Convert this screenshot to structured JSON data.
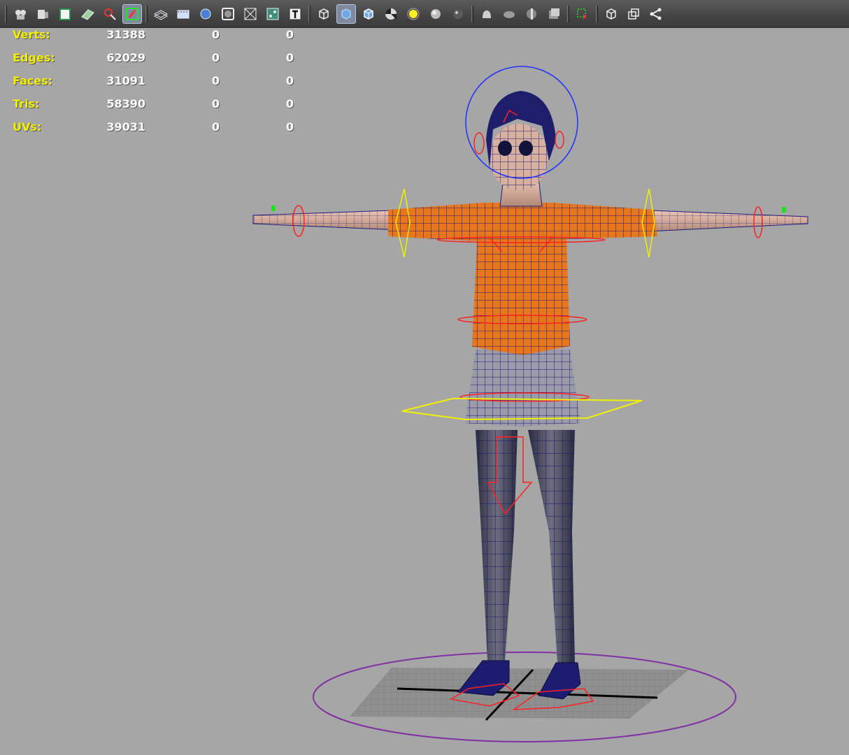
{
  "toolbar": {
    "groups": [
      [
        {
          "icon": "camera-attributes-icon",
          "active": false
        },
        {
          "icon": "camera-film-icon",
          "active": false
        },
        {
          "icon": "bookmark-icon",
          "active": false
        },
        {
          "icon": "image-plane-icon",
          "active": false
        },
        {
          "icon": "two-d-pan-zoom-icon",
          "active": false
        },
        {
          "icon": "grease-pencil-icon",
          "active": true
        }
      ],
      [
        {
          "icon": "grid-icon",
          "active": false
        },
        {
          "icon": "film-gate-icon",
          "active": false
        },
        {
          "icon": "resolution-gate-icon",
          "active": false
        },
        {
          "icon": "gate-mask-icon",
          "active": false
        },
        {
          "icon": "field-chart-icon",
          "active": false
        },
        {
          "icon": "safe-action-icon",
          "active": false
        },
        {
          "icon": "safe-title-icon",
          "active": false
        }
      ],
      [
        {
          "icon": "wireframe-cube-icon",
          "active": false
        },
        {
          "icon": "smooth-shade-cube-icon",
          "active": true
        },
        {
          "icon": "wireframe-on-shaded-icon",
          "active": false
        },
        {
          "icon": "textured-checker-icon",
          "active": false
        },
        {
          "icon": "use-all-lights-icon",
          "active": false
        },
        {
          "icon": "shadows-sphere-icon",
          "active": false
        },
        {
          "icon": "ambient-occlusion-sphere-icon",
          "active": false
        }
      ],
      [
        {
          "icon": "motion-blur-icon",
          "active": false
        },
        {
          "icon": "multisample-aa-icon",
          "active": false
        },
        {
          "icon": "depth-of-field-icon",
          "active": false
        },
        {
          "icon": "screen-space-icon",
          "active": false
        }
      ],
      [
        {
          "icon": "isolate-select-icon",
          "active": false
        }
      ],
      [
        {
          "icon": "xray-cube-icon",
          "active": false
        },
        {
          "icon": "xray-active-components-icon",
          "active": false
        },
        {
          "icon": "xray-joints-icon",
          "active": false
        }
      ]
    ]
  },
  "hud": {
    "rows": [
      {
        "label": "Verts:",
        "v1": "31388",
        "v2": "0",
        "v3": "0"
      },
      {
        "label": "Edges:",
        "v1": "62029",
        "v2": "0",
        "v3": "0"
      },
      {
        "label": "Faces:",
        "v1": "31091",
        "v2": "0",
        "v3": "0"
      },
      {
        "label": "Tris:",
        "v1": "58390",
        "v2": "0",
        "v3": "0"
      },
      {
        "label": "UVs:",
        "v1": "39031",
        "v2": "0",
        "v3": "0"
      }
    ]
  },
  "colors": {
    "viewport_bg": "#a6a6a6",
    "hud_label": "#f2f000",
    "hud_value": "#ffffff",
    "wire": "#1a1a8c",
    "sweater": "#e8761c",
    "control_red": "#ff2020",
    "control_yellow": "#f0f000",
    "control_blue": "#2030ff",
    "ground_circle": "#8030a0"
  }
}
